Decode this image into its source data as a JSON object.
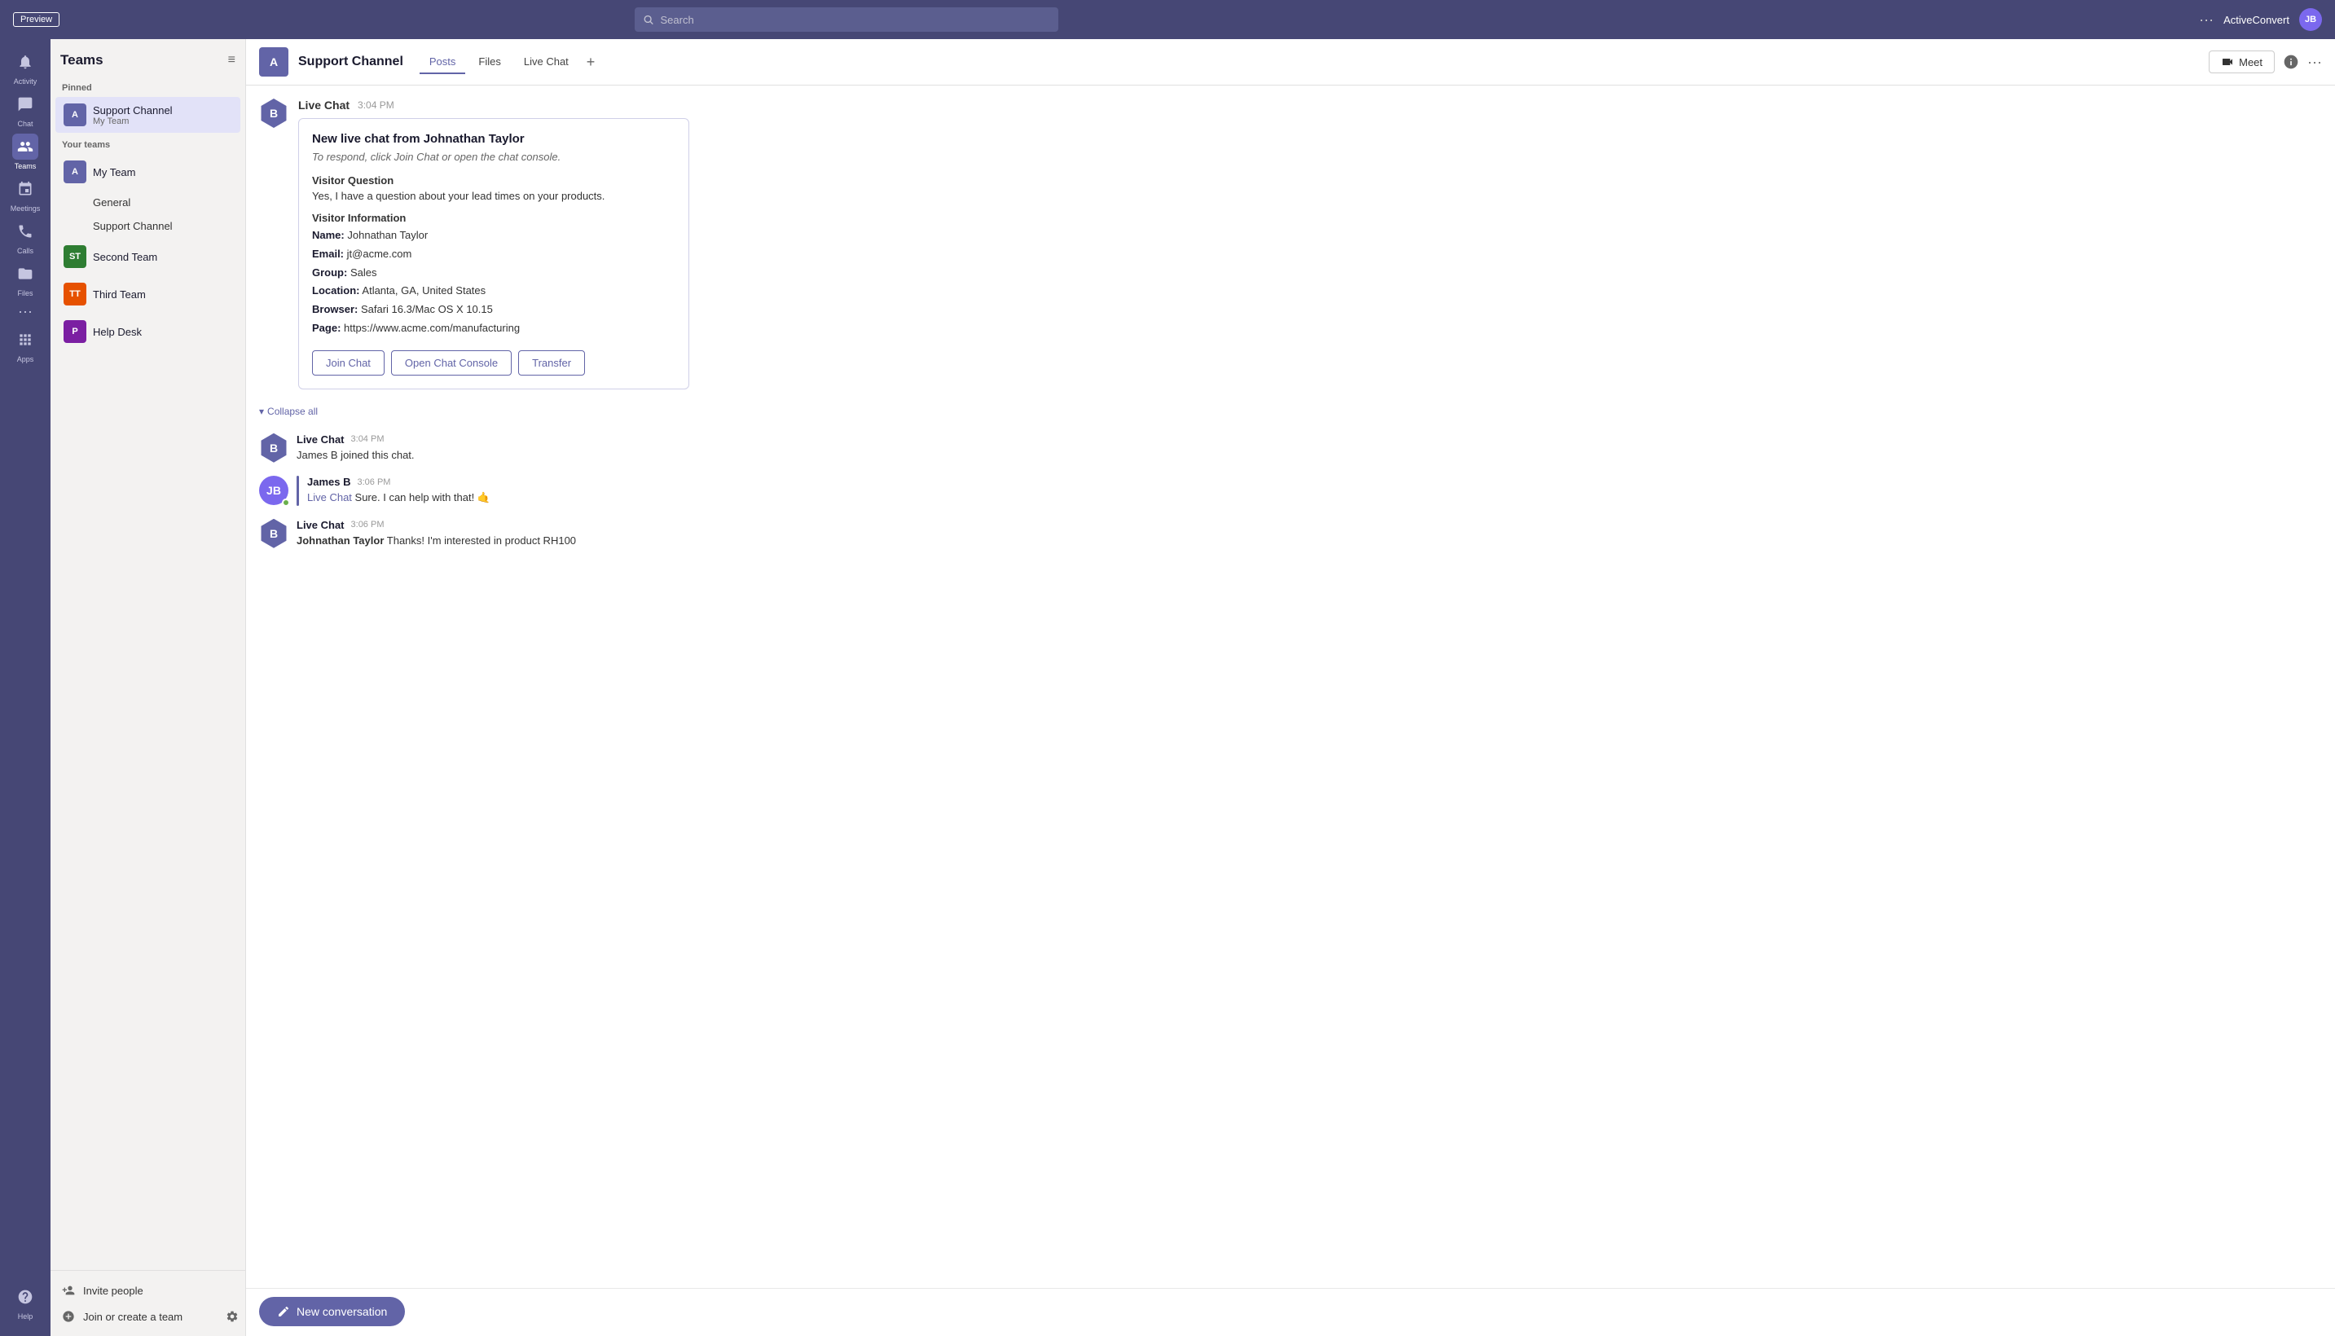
{
  "topbar": {
    "preview_label": "Preview",
    "search_placeholder": "Search",
    "dots": "···",
    "username": "ActiveConvert",
    "avatar_initials": "JB"
  },
  "nav": {
    "items": [
      {
        "id": "activity",
        "label": "Activity",
        "icon": "bell"
      },
      {
        "id": "chat",
        "label": "Chat",
        "icon": "chat"
      },
      {
        "id": "teams",
        "label": "Teams",
        "icon": "teams",
        "active": true
      },
      {
        "id": "meetings",
        "label": "Meetings",
        "icon": "calendar"
      },
      {
        "id": "calls",
        "label": "Calls",
        "icon": "phone"
      },
      {
        "id": "files",
        "label": "Files",
        "icon": "file"
      }
    ],
    "dots_label": "···",
    "apps_label": "Apps",
    "help_label": "Help"
  },
  "sidebar": {
    "title": "Teams",
    "pinned_label": "Pinned",
    "pinned_item": {
      "avatar": "A",
      "avatar_color": "#6264a7",
      "name": "Support Channel",
      "sub": "My Team"
    },
    "your_teams_label": "Your teams",
    "teams": [
      {
        "id": "my-team",
        "avatar": "A",
        "avatar_color": "#6264a7",
        "name": "My Team",
        "channels": [
          "General",
          "Support Channel"
        ]
      },
      {
        "id": "second-team",
        "avatar": "ST",
        "avatar_color": "#2e7d32",
        "name": "Second Team",
        "channels": []
      },
      {
        "id": "third-team",
        "avatar": "TT",
        "avatar_color": "#e65100",
        "name": "Third Team",
        "channels": []
      },
      {
        "id": "help-desk",
        "avatar": "P",
        "avatar_color": "#7b1fa2",
        "name": "Help Desk",
        "channels": []
      }
    ],
    "invite_people": "Invite people",
    "join_create": "Join or create a team"
  },
  "channel": {
    "avatar": "A",
    "avatar_color": "#6264a7",
    "name": "Support Channel",
    "tabs": [
      "Posts",
      "Files",
      "Live Chat"
    ],
    "active_tab": "Posts",
    "meet_label": "Meet"
  },
  "live_chat_notification": {
    "sender": "Live Chat",
    "time": "3:04 PM",
    "title": "New live chat from Johnathan Taylor",
    "subtitle": "To respond, click Join Chat or open the chat console.",
    "visitor_question_label": "Visitor Question",
    "visitor_question": "Yes, I have a question about your lead times on your products.",
    "visitor_info_label": "Visitor Information",
    "name_label": "Name:",
    "name_value": "Johnathan Taylor",
    "email_label": "Email:",
    "email_value": "jt@acme.com",
    "group_label": "Group:",
    "group_value": "Sales",
    "location_label": "Location:",
    "location_value": "Atlanta, GA, United States",
    "browser_label": "Browser:",
    "browser_value": "Safari 16.3/Mac OS X 10.15",
    "page_label": "Page:",
    "page_value": "https://www.acme.com/manufacturing",
    "btn_join": "Join Chat",
    "btn_console": "Open Chat Console",
    "btn_transfer": "Transfer"
  },
  "collapse_all_label": "Collapse all",
  "messages": [
    {
      "id": "msg1",
      "type": "system",
      "sender": "Live Chat",
      "time": "3:04 PM",
      "text": "James B joined this chat.",
      "avatar_color": "#6264a7",
      "avatar": "B"
    },
    {
      "id": "msg2",
      "type": "user",
      "sender": "James B",
      "time": "3:06 PM",
      "avatar": "JB",
      "avatar_color": "#7b68ee",
      "live_chat_prefix": "Live Chat",
      "text": " Sure.  I can help with that! 🤙",
      "has_bar": true
    },
    {
      "id": "msg3",
      "type": "system",
      "sender": "Live Chat",
      "time": "3:06 PM",
      "avatar": "B",
      "avatar_color": "#6264a7",
      "bold_prefix": "Johnathan Taylor",
      "text": " Thanks! I'm interested in product RH100"
    }
  ],
  "new_conversation_label": "New conversation"
}
